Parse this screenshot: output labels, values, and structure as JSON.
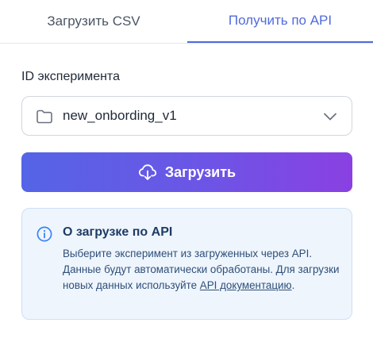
{
  "tabs": [
    {
      "label": "Загрузить CSV",
      "active": false
    },
    {
      "label": "Получить по API",
      "active": true
    }
  ],
  "experiment": {
    "label": "ID эксперимента",
    "selected_value": "new_onbording_v1",
    "icon": "folder-icon"
  },
  "upload_button": {
    "label": "Загрузить",
    "icon": "cloud-download-icon"
  },
  "info": {
    "title": "О загрузке по API",
    "text_before_link": "Выберите эксперимент из загруженных через API. Данные будут автоматически обработаны. Для загрузки новых данных используйте ",
    "link_text": "API документацию",
    "text_after_link": "."
  },
  "colors": {
    "accent": "#4f6bdc",
    "button_gradient_start": "#5564e7",
    "button_gradient_end": "#8a40e2",
    "info_background": "#eef5fd",
    "info_border": "#cfe0f5"
  }
}
